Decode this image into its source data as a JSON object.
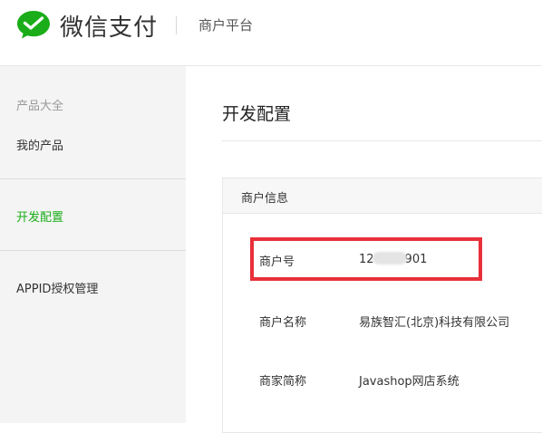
{
  "header": {
    "brand": "微信支付",
    "platform": "商户平台",
    "logo_icon": "wechat-pay-logo-icon"
  },
  "colors": {
    "accent": "#1aad19",
    "highlight": "#e8303a"
  },
  "sidebar": {
    "section_label": "产品大全",
    "items": [
      {
        "label": "我的产品",
        "active": false
      },
      {
        "label": "开发配置",
        "active": true
      },
      {
        "label": "APPID授权管理",
        "active": false
      }
    ]
  },
  "main": {
    "title": "开发配置",
    "panel": {
      "header": "商户信息",
      "fields": [
        {
          "label": "商户号",
          "value_prefix": "12",
          "value_suffix": "901",
          "masked": true
        },
        {
          "label": "商户名称",
          "value": "易族智汇(北京)科技有限公司"
        },
        {
          "label": "商家简称",
          "value": "Javashop网店系统"
        }
      ]
    }
  }
}
